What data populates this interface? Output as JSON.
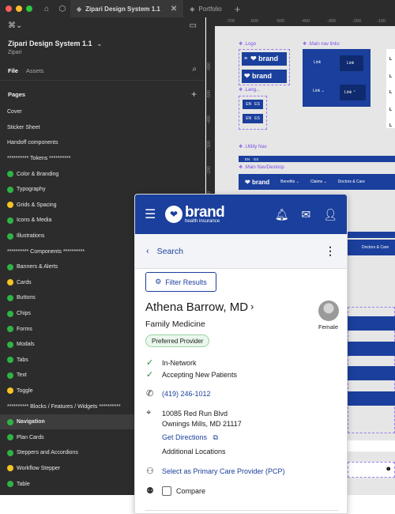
{
  "topbar": {
    "tabs": [
      {
        "label": "Zipari Design System 1.1",
        "active": true
      },
      {
        "label": "Portfolio",
        "active": false
      }
    ],
    "traffic_lights": [
      "#ff5f57",
      "#febc2e",
      "#28c840"
    ]
  },
  "sidebar": {
    "file_name": "Zipari Design System 1.1",
    "file_sub": "Zipari",
    "tab_file": "File",
    "tab_assets": "Assets",
    "pages_title": "Pages",
    "pages": [
      {
        "label": "Cover",
        "dot": ""
      },
      {
        "label": "Sticker Sheet",
        "dot": ""
      },
      {
        "label": "Handoff components",
        "dot": ""
      },
      {
        "label": "********** Tokens **********",
        "dot": ""
      },
      {
        "label": "Color & Branding",
        "dot": "#2fb344"
      },
      {
        "label": "Typography",
        "dot": "#2fb344"
      },
      {
        "label": "Grids & Spacing",
        "dot": "#f5c324"
      },
      {
        "label": "Icons & Media",
        "dot": "#2fb344"
      },
      {
        "label": "Illustrations",
        "dot": "#2fb344"
      },
      {
        "label": "********** Components **********",
        "dot": ""
      },
      {
        "label": "Banners & Alerts",
        "dot": "#2fb344"
      },
      {
        "label": "Cards",
        "dot": "#f5c324"
      },
      {
        "label": "Buttons",
        "dot": "#2fb344"
      },
      {
        "label": "Chips",
        "dot": "#2fb344"
      },
      {
        "label": "Forms",
        "dot": "#2fb344"
      },
      {
        "label": "Modals",
        "dot": "#2fb344"
      },
      {
        "label": "Tabs",
        "dot": "#2fb344"
      },
      {
        "label": "Text",
        "dot": "#2fb344"
      },
      {
        "label": "Toggle",
        "dot": "#f5c324"
      },
      {
        "label": "********** Blocks / Features / Widgets **********",
        "dot": ""
      },
      {
        "label": "Navigation",
        "dot": "#2fb344",
        "selected": true
      },
      {
        "label": "Plan Cards",
        "dot": "#2fb344"
      },
      {
        "label": "Steppers and Accordions",
        "dot": "#2fb344"
      },
      {
        "label": "Workflow Stepper",
        "dot": "#f5c324"
      },
      {
        "label": "Table",
        "dot": "#2fb344"
      }
    ]
  },
  "canvas": {
    "ruler_top": [
      "-700",
      "-600",
      "-500",
      "-400",
      "-300",
      "-200",
      "-100"
    ],
    "ruler_left": [
      "-600",
      "-500",
      "-400",
      "-300",
      "-200",
      "-100"
    ],
    "labels": {
      "logo": ".Logo",
      "main_nav_links": ".Main nav links",
      "lang": ".Lang...",
      "utility_nav": ".Utility Nav",
      "main_nav_desktop": ".Main Nav/Desktop"
    },
    "link": "Link",
    "en": "EN",
    "es": "ES",
    "nav_items": [
      "Benefits ⌄",
      "Claims ⌄",
      "Doctors & Care"
    ],
    "doctors_care": "Doctors & Care",
    "brand": "brand",
    "brand_sub": "health insurance"
  },
  "card": {
    "brand": "brand",
    "brand_sub": "health insurance",
    "back_label": "Search",
    "filter_label": "Filter Results",
    "provider_name": "Athena Barrow, MD",
    "specialty": "Family Medicine",
    "badge": "Preferred Provider",
    "gender": "Female",
    "in_network": "In-Network",
    "accepting": "Accepting New Patients",
    "phone": "(419) 246-1012",
    "address_line1": "10085 Red Run Blvd",
    "address_line2": "Ownings Mills, MD 21117",
    "directions": "Get Directions",
    "additional_locations": "Additional Locations",
    "select_pcp": "Select as Primary Care Provider (PCP)",
    "compare": "Compare",
    "brand_color": "#1b3f9c"
  }
}
